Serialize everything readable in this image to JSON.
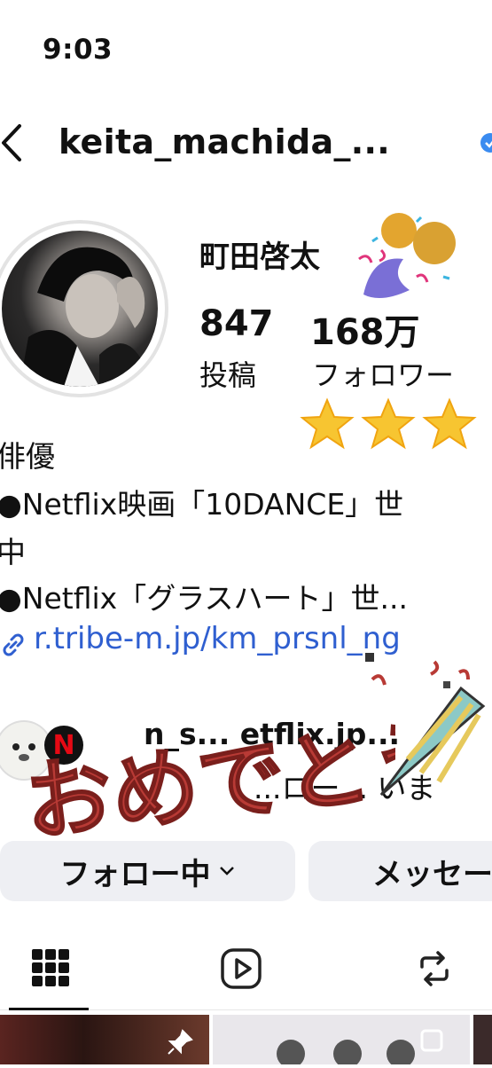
{
  "status_bar": {
    "time": "9:03"
  },
  "header": {
    "username": "keita_machida_..."
  },
  "profile": {
    "full_name": "町田啓太",
    "stats": [
      {
        "value": "847",
        "label": "投稿"
      },
      {
        "value": "168万",
        "label": "フォロワー"
      }
    ],
    "bio_lines": [
      "俳優",
      "●Netflix映画「10DANCE」世",
      "中",
      "●Netflix「グラスハート」世..."
    ],
    "link": "r.tribe-m.jp/km_prsnl_ng",
    "follower_preview_partial": "n_s... etflix.jp...",
    "follower_preview_partial2": "...ロー... いま"
  },
  "actions": {
    "following_label": "フォロー中",
    "message_label": "メッセー"
  },
  "sticker": {
    "text": "おめでとう"
  },
  "colors": {
    "link": "#2f5fd0",
    "button_bg": "#eeeff3",
    "sticker_red": "#b83a35"
  },
  "tabs": [
    "grid-icon",
    "reels-icon",
    "reposts-icon"
  ]
}
